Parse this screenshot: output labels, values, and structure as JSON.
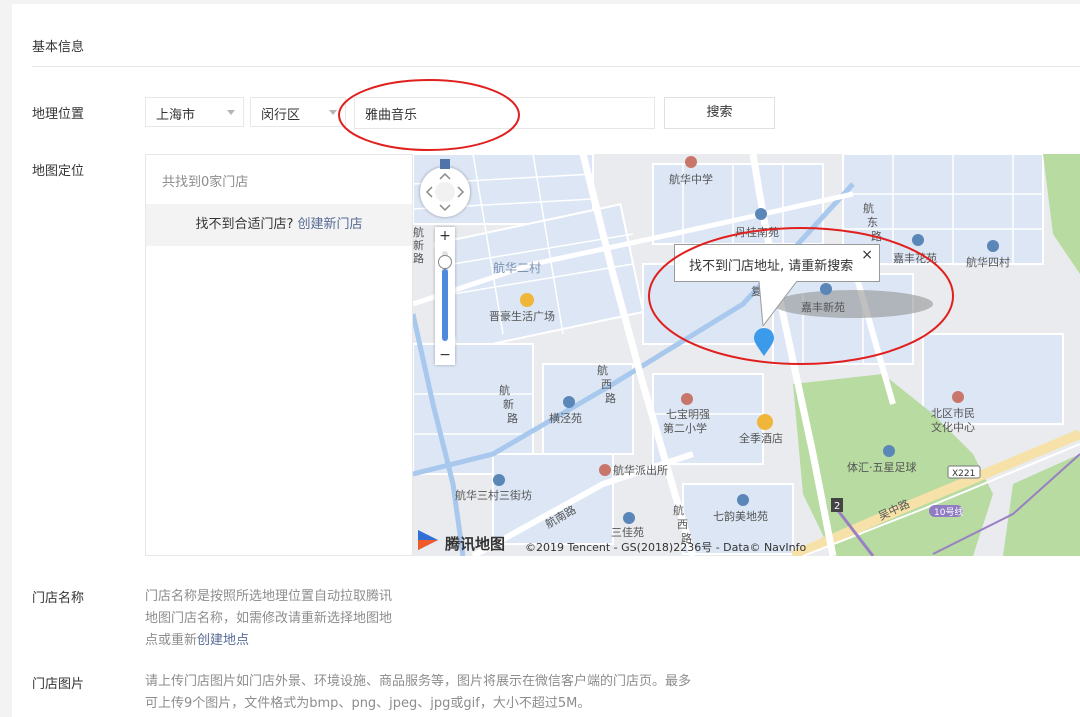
{
  "section_title": "基本信息",
  "location": {
    "label": "地理位置",
    "city": "上海市",
    "district": "闵行区",
    "search_value": "雅曲音乐",
    "search_button": "搜索"
  },
  "map_section": {
    "label": "地图定位",
    "result_count": "共找到0家门店",
    "not_found_text": "找不到合适门店?",
    "create_link": "创建新门店",
    "popup_text": "找不到门店地址, 请重新搜索",
    "popup_close": "×",
    "zoom_plus": "+",
    "zoom_minus": "−",
    "logo_text": "腾讯地图",
    "copyright": "©2019 Tencent - GS(2018)2236号 - Data© NavInfo",
    "place_labels": {
      "hanghua_middle": "航华中学",
      "danyu_nanyuan": "丹桂南苑",
      "jiafeng_huayuan": "嘉丰花苑",
      "hanghua_4": "航华四村",
      "hanghua_2": "航华二村",
      "jinhao": "晋豪生活广场",
      "fuzhou": "复泰园",
      "jiafeng_xinyuan": "嘉丰新苑",
      "hangxin_road": "航新路",
      "hangxi_road": "航西路",
      "hengjing": "横泾苑",
      "qibao_school": "七宝明强第二小学",
      "quanji": "全季酒店",
      "beiqu": "北区市民文化中心",
      "tixin": "体汇·五星足球",
      "police": "航华派出所",
      "hanghua_3": "航华三村三街坊",
      "hangnan_road": "航南路",
      "sanjia": "三佳苑",
      "qiyun": "七韵美地苑",
      "wuzhong": "吴中路",
      "hangdong_road": "航东路",
      "x221": "X221",
      "line10": "10号线",
      "n2": "2"
    }
  },
  "store_name": {
    "label": "门店名称",
    "hint_line1": "门店名称是按照所选地理位置自动拉取腾讯",
    "hint_line2": "地图门店名称，如需修改请重新选择地图地",
    "hint_line3_prefix": "点或重新",
    "hint_link": "创建地点"
  },
  "store_image": {
    "label": "门店图片",
    "hint_line1": "请上传门店图片如门店外景、环境设施、商品服务等，图片将展示在微信客户端的门店页。最多",
    "hint_line2": "可上传9个图片，文件格式为bmp、png、jpeg、jpg或gif，大小不超过5M。"
  },
  "colors": {
    "annotation_red": "#e0201e",
    "marker_blue": "#3b9bea",
    "link_blue": "#576b95",
    "water": "#a8c8ee",
    "park": "#b7dba0",
    "block": "#dce6f5",
    "road": "#ffffff",
    "main_road": "#f6e2a8"
  }
}
